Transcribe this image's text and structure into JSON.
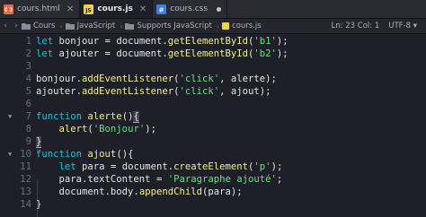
{
  "tabs": [
    {
      "label": "cours.html",
      "icon": "html-file-icon",
      "color": "#e86a3e",
      "glyph": "<>",
      "active": false
    },
    {
      "label": "cours.js",
      "icon": "js-file-icon",
      "color": "#f5d33a",
      "glyph": "JS",
      "active": true
    },
    {
      "label": "cours.css",
      "icon": "css-file-icon",
      "color": "#3d7ee6",
      "glyph": "#",
      "active": false
    }
  ],
  "breadcrumb": {
    "items": [
      "Cours",
      "JavaScript",
      "Supports JavaScript",
      "cours.js"
    ],
    "position": "Ln: 23 Col: 1",
    "encoding": "UTF-8"
  },
  "code_lines": [
    {
      "n": "1",
      "html": "<span class='kw'>let</span> bonjour <span class='op'>=</span> document.<span class='fn'>getElementById</span>(<span class='str'>'b1'</span>);"
    },
    {
      "n": "2",
      "html": "<span class='kw'>let</span> ajouter <span class='op'>=</span> document.<span class='fn'>getElementById</span>(<span class='str'>'b2'</span>);"
    },
    {
      "n": "3",
      "html": ""
    },
    {
      "n": "4",
      "html": "bonjour.<span class='fn'>addEventListener</span>(<span class='str'>'click'</span>, alerte);"
    },
    {
      "n": "5",
      "html": "ajouter.<span class='fn'>addEventListener</span>(<span class='str'>'click'</span>, ajout);"
    },
    {
      "n": "6",
      "html": ""
    },
    {
      "n": "7",
      "html": "<span class='kw'>function</span> <span class='fn'>alerte</span>()<span class='bhl'>{</span>",
      "fold": true
    },
    {
      "n": "8",
      "html": "    <span class='fn'>alert</span>(<span class='str'>'Bonjour'</span>);"
    },
    {
      "n": "9",
      "html": "<span class='bhl'>}</span>"
    },
    {
      "n": "10",
      "html": "<span class='kw'>function</span> <span class='fn'>ajout</span>(){",
      "fold": true
    },
    {
      "n": "11",
      "html": "    <span class='kw'>let</span> para <span class='op'>=</span> document.<span class='fn'>createElement</span>(<span class='str'>'p'</span>);"
    },
    {
      "n": "12",
      "html": "    para.textContent <span class='op'>=</span> <span class='str'>'Paragraphe ajouté'</span>;"
    },
    {
      "n": "13",
      "html": "    document.body.<span class='fn'>appendChild</span>(para);"
    },
    {
      "n": "14",
      "html": "}"
    }
  ],
  "colors": {
    "keyword": "#00d1de",
    "function": "#f2f287",
    "string": "#67e27b",
    "background": "#1e1f29"
  }
}
